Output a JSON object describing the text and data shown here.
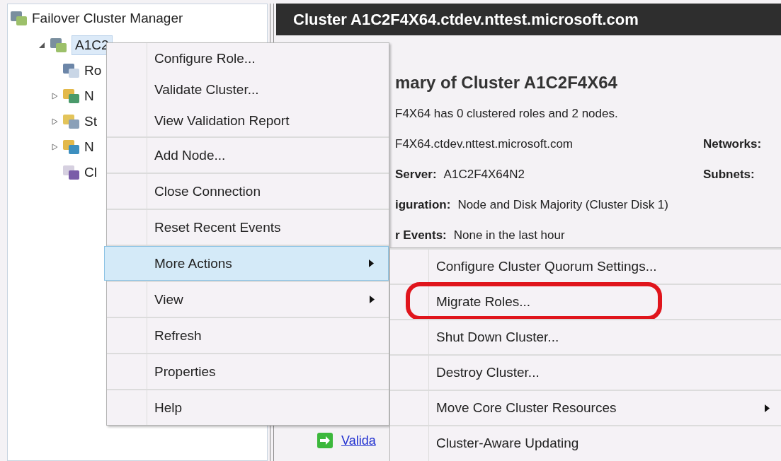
{
  "tree": {
    "title": "Failover Cluster Manager",
    "items": [
      {
        "label": "A1C2",
        "selected": true,
        "expanded": true,
        "children": [
          {
            "label": "Ro"
          },
          {
            "label": "N",
            "expanded": false
          },
          {
            "label": "St",
            "expanded": false
          },
          {
            "label": "N",
            "expanded": false
          },
          {
            "label": "Cl"
          }
        ]
      }
    ]
  },
  "header": {
    "title": "Cluster A1C2F4X64.ctdev.nttest.microsoft.com"
  },
  "summary": {
    "heading": "mary of Cluster A1C2F4X64",
    "description": "F4X64 has 0 clustered roles and 2 nodes.",
    "rows": [
      {
        "value": "F4X64.ctdev.nttest.microsoft.com",
        "side_label": "Networks:"
      },
      {
        "label": "Server:",
        "value": "A1C2F4X64N2",
        "side_label": "Subnets:"
      },
      {
        "label": "iguration:",
        "value": "Node and Disk Majority (Cluster Disk 1)"
      },
      {
        "label": "r Events:",
        "value": "None in the last hour"
      }
    ],
    "link": "Valida"
  },
  "context_menu": {
    "groups": [
      [
        {
          "label": "Configure Role...",
          "submenu": false,
          "selected": false
        },
        {
          "label": "Validate Cluster...",
          "submenu": false,
          "selected": false
        },
        {
          "label": "View Validation Report",
          "submenu": false,
          "selected": false
        }
      ],
      [
        {
          "label": "Add Node...",
          "submenu": false,
          "selected": false
        }
      ],
      [
        {
          "label": "Close Connection",
          "submenu": false,
          "selected": false
        }
      ],
      [
        {
          "label": "Reset Recent Events",
          "submenu": false,
          "selected": false
        }
      ],
      [
        {
          "label": "More Actions",
          "submenu": true,
          "selected": true
        }
      ],
      [
        {
          "label": "View",
          "submenu": true,
          "selected": false
        }
      ],
      [
        {
          "label": "Refresh",
          "submenu": false,
          "selected": false
        }
      ],
      [
        {
          "label": "Properties",
          "submenu": false,
          "selected": false
        }
      ],
      [
        {
          "label": "Help",
          "submenu": false,
          "selected": false
        }
      ]
    ]
  },
  "submenu": {
    "items": [
      {
        "label": "Configure Cluster Quorum Settings...",
        "submenu": false,
        "circled": false
      },
      {
        "label": "Migrate Roles...",
        "submenu": false,
        "circled": true
      },
      {
        "label": "Shut Down Cluster...",
        "submenu": false,
        "circled": false
      },
      {
        "label": "Destroy Cluster...",
        "submenu": false,
        "circled": false
      },
      {
        "label": "Move Core Cluster Resources",
        "submenu": true,
        "circled": false
      },
      {
        "label": "Cluster-Aware Updating",
        "submenu": false,
        "circled": false
      }
    ]
  }
}
